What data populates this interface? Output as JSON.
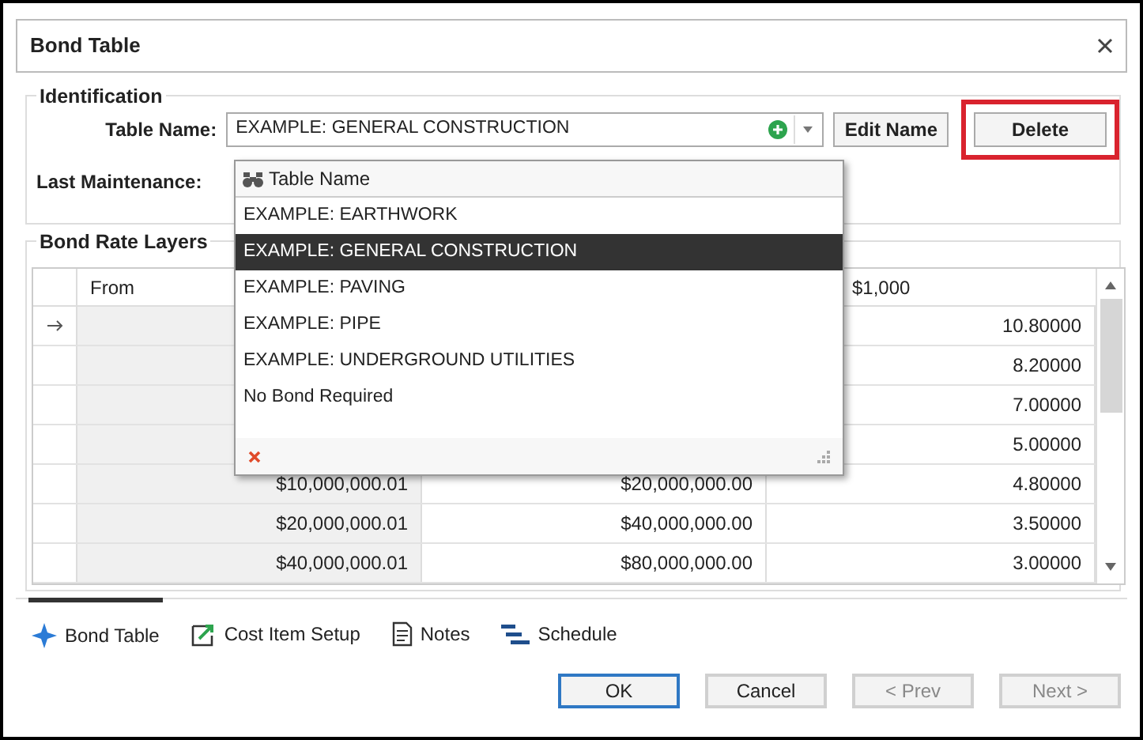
{
  "window": {
    "title": "Bond Table"
  },
  "identification": {
    "title": "Identification",
    "table_name_label": "Table Name:",
    "table_name_value": "EXAMPLE: GENERAL CONSTRUCTION",
    "last_maintenance_label": "Last Maintenance:",
    "buttons": [
      {
        "label": "Edit Name",
        "highlighted": false
      },
      {
        "label": "Delete",
        "highlighted": true
      }
    ]
  },
  "dropdown": {
    "header": "Table Name",
    "items": [
      {
        "label": "EXAMPLE: EARTHWORK",
        "selected": false
      },
      {
        "label": "EXAMPLE: GENERAL CONSTRUCTION",
        "selected": true
      },
      {
        "label": "EXAMPLE: PAVING",
        "selected": false
      },
      {
        "label": "EXAMPLE: PIPE",
        "selected": false
      },
      {
        "label": "EXAMPLE: UNDERGROUND UTILITIES",
        "selected": false
      },
      {
        "label": "No Bond Required",
        "selected": false
      }
    ]
  },
  "bond_rate_layers": {
    "title": "Bond Rate Layers",
    "headers": {
      "from": "From",
      "column_3": "$1,000"
    },
    "rows": [
      {
        "current": true,
        "rate": "10.80000"
      },
      {
        "current": false,
        "rate": "8.20000"
      },
      {
        "current": false,
        "rate": "7.00000"
      },
      {
        "current": false,
        "rate": "5.00000"
      },
      {
        "current": false,
        "from": "$10,000,000.01",
        "to": "$20,000,000.00",
        "rate": "4.80000"
      },
      {
        "current": false,
        "from": "$20,000,000.01",
        "to": "$40,000,000.00",
        "rate": "3.50000"
      },
      {
        "current": false,
        "from": "$40,000,000.01",
        "to": "$80,000,000.00",
        "rate": "3.00000"
      }
    ]
  },
  "tabs": [
    {
      "label": "Bond Table",
      "selected": true
    },
    {
      "label": "Cost Item Setup",
      "selected": false
    },
    {
      "label": "Notes",
      "selected": false
    },
    {
      "label": "Schedule",
      "selected": false
    }
  ],
  "buttons": [
    {
      "label": "OK",
      "kind": "default",
      "disabled": false
    },
    {
      "label": "Cancel",
      "kind": "normal",
      "disabled": false
    },
    {
      "label": "< Prev",
      "kind": "normal",
      "disabled": true
    },
    {
      "label": "Next >",
      "kind": "normal",
      "disabled": true
    }
  ]
}
